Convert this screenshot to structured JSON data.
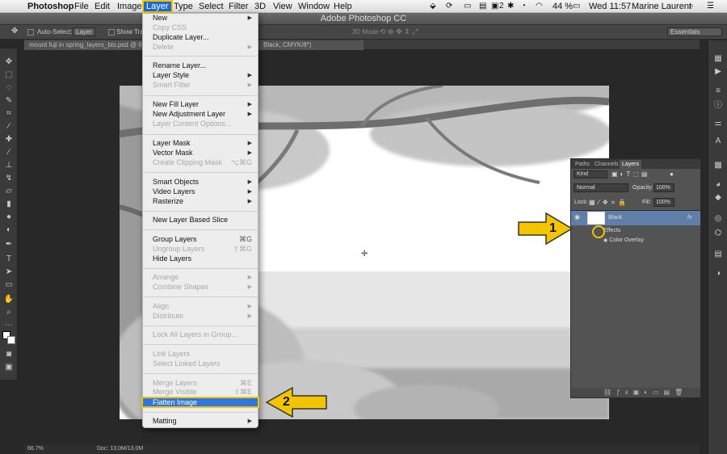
{
  "menubar": {
    "app_name": "Photoshop",
    "items": [
      "File",
      "Edit",
      "Image",
      "Layer",
      "Type",
      "Select",
      "Filter",
      "3D",
      "View",
      "Window",
      "Help"
    ],
    "active_item": "Layer",
    "status": {
      "battery": "44 %",
      "clock": "Wed 11:57",
      "user": "Marine Laurent",
      "badge": "2"
    }
  },
  "window_title": "Adobe Photoshop CC",
  "options_bar": {
    "auto_select_label": "Auto-Select:",
    "auto_select_value": "Layer",
    "show_transform_label": "Show Transf",
    "mode_3d_label": "3D Mode:",
    "workspace": "Essentials"
  },
  "document_tabs": {
    "tab1": "mount fuji in spring_layers_bis.psd @ 66.7",
    "tab2": "Black, CMYK/8*)"
  },
  "layer_menu": {
    "items": [
      {
        "label": "New",
        "submenu": true
      },
      {
        "label": "Copy CSS",
        "disabled": true
      },
      {
        "label": "Duplicate Layer..."
      },
      {
        "label": "Delete",
        "disabled": true,
        "submenu": true
      },
      {
        "label": "Rename Layer..."
      },
      {
        "label": "Layer Style",
        "submenu": true
      },
      {
        "label": "Smart Filter",
        "disabled": true,
        "submenu": true
      },
      {
        "label": "New Fill Layer",
        "submenu": true
      },
      {
        "label": "New Adjustment Layer",
        "submenu": true
      },
      {
        "label": "Layer Content Options...",
        "disabled": true
      },
      {
        "label": "Layer Mask",
        "submenu": true
      },
      {
        "label": "Vector Mask",
        "submenu": true
      },
      {
        "label": "Create Clipping Mask",
        "disabled": true,
        "shortcut": "⌥⌘G"
      },
      {
        "label": "Smart Objects",
        "submenu": true
      },
      {
        "label": "Video Layers",
        "submenu": true
      },
      {
        "label": "Rasterize",
        "submenu": true
      },
      {
        "label": "New Layer Based Slice"
      },
      {
        "label": "Group Layers",
        "shortcut": "⌘G"
      },
      {
        "label": "Ungroup Layers",
        "disabled": true,
        "shortcut": "⇧⌘G"
      },
      {
        "label": "Hide Layers"
      },
      {
        "label": "Arrange",
        "disabled": true,
        "submenu": true
      },
      {
        "label": "Combine Shapes",
        "disabled": true,
        "submenu": true
      },
      {
        "label": "Align",
        "disabled": true,
        "submenu": true
      },
      {
        "label": "Distribute",
        "disabled": true,
        "submenu": true
      },
      {
        "label": "Lock All Layers in Group...",
        "disabled": true
      },
      {
        "label": "Link Layers",
        "disabled": true
      },
      {
        "label": "Select Linked Layers",
        "disabled": true
      },
      {
        "label": "Merge Layers",
        "disabled": true,
        "shortcut": "⌘E"
      },
      {
        "label": "Merge Visible",
        "disabled": true,
        "shortcut": "⇧⌘E"
      },
      {
        "label": "Flatten Image",
        "highlighted": true
      },
      {
        "label": "Matting",
        "submenu": true
      }
    ]
  },
  "layers_panel": {
    "tabs": [
      "Paths",
      "Channels",
      "Layers"
    ],
    "active_tab": "Layers",
    "filter_kind": "Kind",
    "blend_mode": "Normal",
    "opacity_label": "Opacity:",
    "opacity_value": "100%",
    "lock_label": "Lock:",
    "fill_label": "Fill:",
    "fill_value": "100%",
    "layer_name": "Black",
    "fx_label": "fx",
    "effects_label": "Effects",
    "effect_item": "Color Overlay"
  },
  "callouts": {
    "one": "1",
    "two": "2"
  },
  "status_bar": {
    "zoom": "66.7%",
    "doc": "Doc: 13,0M/13,0M"
  },
  "colors": {
    "accent": "#2f76e0",
    "callout": "#f5c400",
    "selected_layer": "#5f7fa8"
  }
}
